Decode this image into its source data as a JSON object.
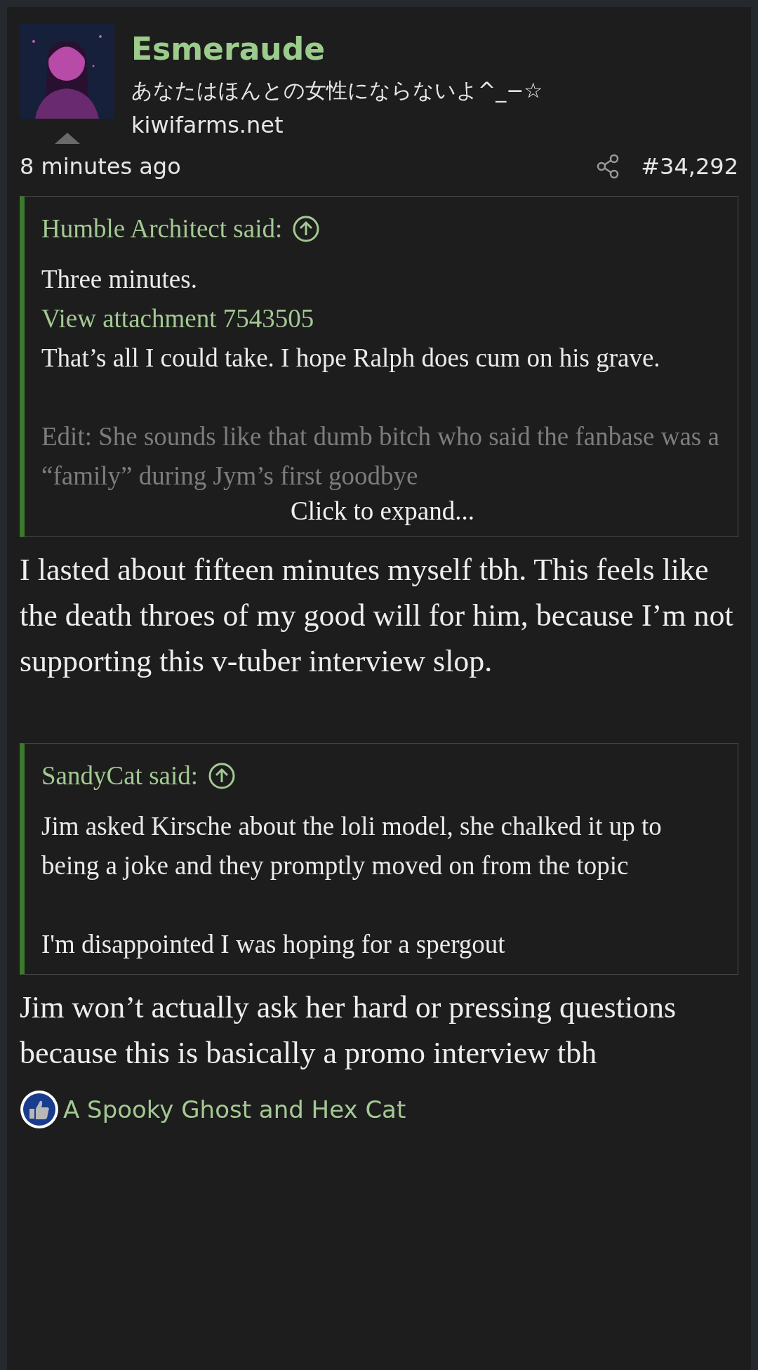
{
  "post": {
    "author": {
      "name": "Esmeraude",
      "title": "あなたはほんとの女性にならないよ^_−☆",
      "site": "kiwifarms.net"
    },
    "time": "8 minutes ago",
    "number": "#34,292",
    "blocks": [
      {
        "kind": "quote",
        "author": "Humble Architect said:",
        "expand": "Click to expand...",
        "paragraphs": [
          {
            "kind": "line",
            "text": "Three minutes."
          },
          {
            "kind": "link",
            "text": "View attachment 7543505"
          },
          {
            "kind": "line",
            "text": "That’s all I could take. I hope Ralph does cum on his grave."
          },
          {
            "kind": "faded",
            "text": "Edit: She sounds like that dumb bitch who said the fanbase was a “family” during Jym’s first goodbye"
          }
        ]
      },
      {
        "kind": "text",
        "text": "I lasted about fifteen minutes myself tbh. This feels like the death throes of my good will for him, because I’m not supporting this v-tuber interview slop."
      },
      {
        "kind": "quote",
        "author": "SandyCat said:",
        "paragraphs": [
          {
            "kind": "line",
            "text": "Jim asked Kirsche about the loli model, she chalked it up to being a joke and they promptly moved on from the topic"
          },
          {
            "kind": "paragraph",
            "text": "I'm disappointed I was hoping for a spergout"
          }
        ]
      },
      {
        "kind": "text",
        "text": "Jim won’t actually ask her hard or pressing questions because this is basically a promo interview tbh"
      }
    ],
    "reactions": "A Spooky Ghost and Hex Cat"
  }
}
